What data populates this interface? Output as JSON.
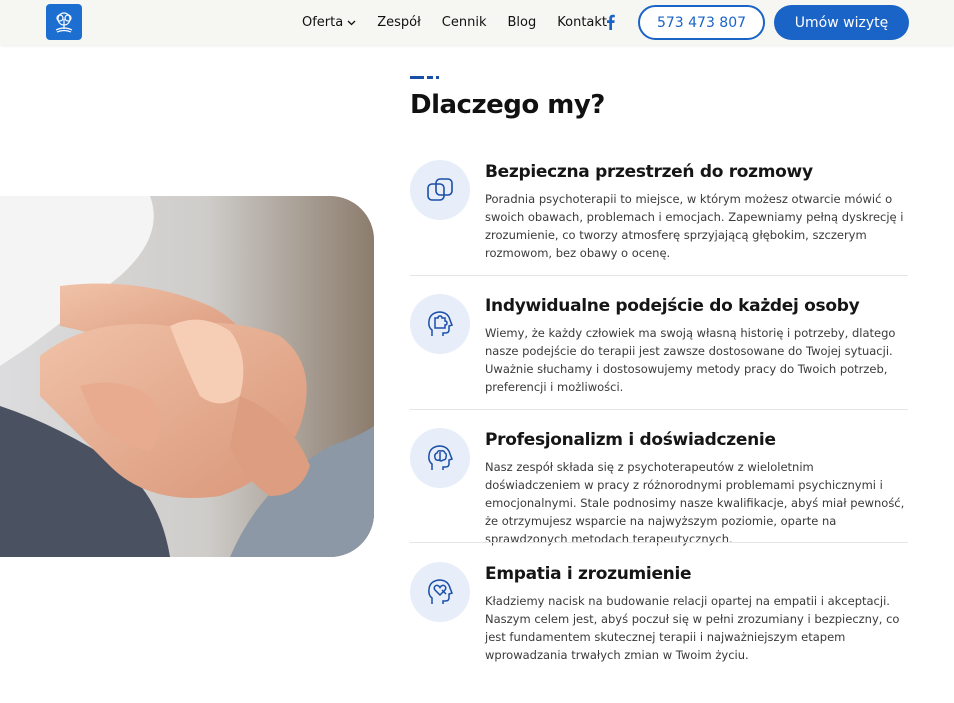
{
  "header": {
    "nav": [
      {
        "label": "Oferta",
        "has_dropdown": true
      },
      {
        "label": "Zespół"
      },
      {
        "label": "Cennik"
      },
      {
        "label": "Blog"
      },
      {
        "label": "Kontakt"
      }
    ],
    "phone": "573 473 807",
    "book_label": "Umów wizytę",
    "brand_color": "#1a63c7"
  },
  "section": {
    "title": "Dlaczego my?",
    "features": [
      {
        "icon": "overlapping-squares-icon",
        "title": "Bezpieczna przestrzeń do rozmowy",
        "text": "Poradnia psychoterapii to miejsce, w którym możesz otwarcie mówić o swoich obawach, problemach i emocjach. Zapewniamy pełną dyskrecję i zrozumienie, co tworzy atmosferę sprzyjającą głębokim, szczerym rozmowom, bez obawy o ocenę."
      },
      {
        "icon": "puzzle-head-icon",
        "title": "Indywidualne podejście do każdej osoby",
        "text": "Wiemy, że każdy człowiek ma swoją własną historię i potrzeby, dlatego nasze podejście do terapii jest zawsze dostosowane do Twojej sytuacji. Uważnie słuchamy i dostosowujemy metody pracy do Twoich potrzeb, preferencji i możliwości."
      },
      {
        "icon": "brain-head-icon",
        "title": "Profesjonalizm i doświadczenie",
        "text": "Nasz zespół składa się z psychoterapeutów z wieloletnim doświadczeniem w pracy z różnorodnymi problemami psychicznymi i emocjonalnymi. Stale podnosimy nasze kwalifikacje, abyś miał pewność, że otrzymujesz wsparcie na najwyższym poziomie, oparte na sprawdzonych metodach terapeutycznych."
      },
      {
        "icon": "heart-head-icon",
        "title": "Empatia i zrozumienie",
        "text": "Kładziemy nacisk na budowanie relacji opartej na empatii i akceptacji. Naszym celem jest, abyś poczuł się w pełni zrozumiany i bezpieczny, co jest fundamentem skutecznej terapii i najważniejszym etapem wprowadzania trwałych zmian w Twoim życiu."
      }
    ]
  }
}
